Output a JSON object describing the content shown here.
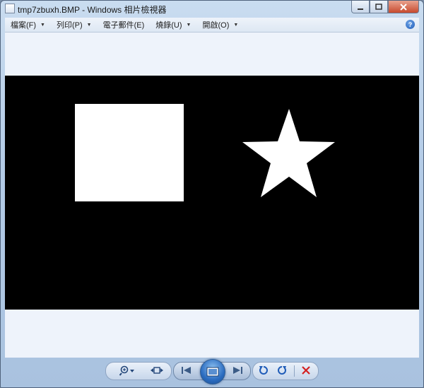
{
  "window": {
    "title": "tmp7zbuxh.BMP - Windows 相片檢視器"
  },
  "menu": [
    {
      "label": "檔案(F)"
    },
    {
      "label": "列印(P)"
    },
    {
      "label": "電子郵件(E)"
    },
    {
      "label": "燒錄(U)"
    },
    {
      "label": "開啟(O)"
    }
  ],
  "help": {
    "glyph": "?"
  },
  "image": {
    "shapes": [
      "square",
      "star"
    ],
    "background_color": "#000000",
    "shape_color": "#ffffff"
  },
  "toolbar": {
    "icons": [
      "zoom-icon",
      "actual-size-icon",
      "previous-icon",
      "slideshow-icon",
      "next-icon",
      "rotate-left-icon",
      "rotate-right-icon",
      "delete-icon"
    ]
  },
  "colors": {
    "delete": "#d42020",
    "viewer_bg": "#eef3fb"
  }
}
